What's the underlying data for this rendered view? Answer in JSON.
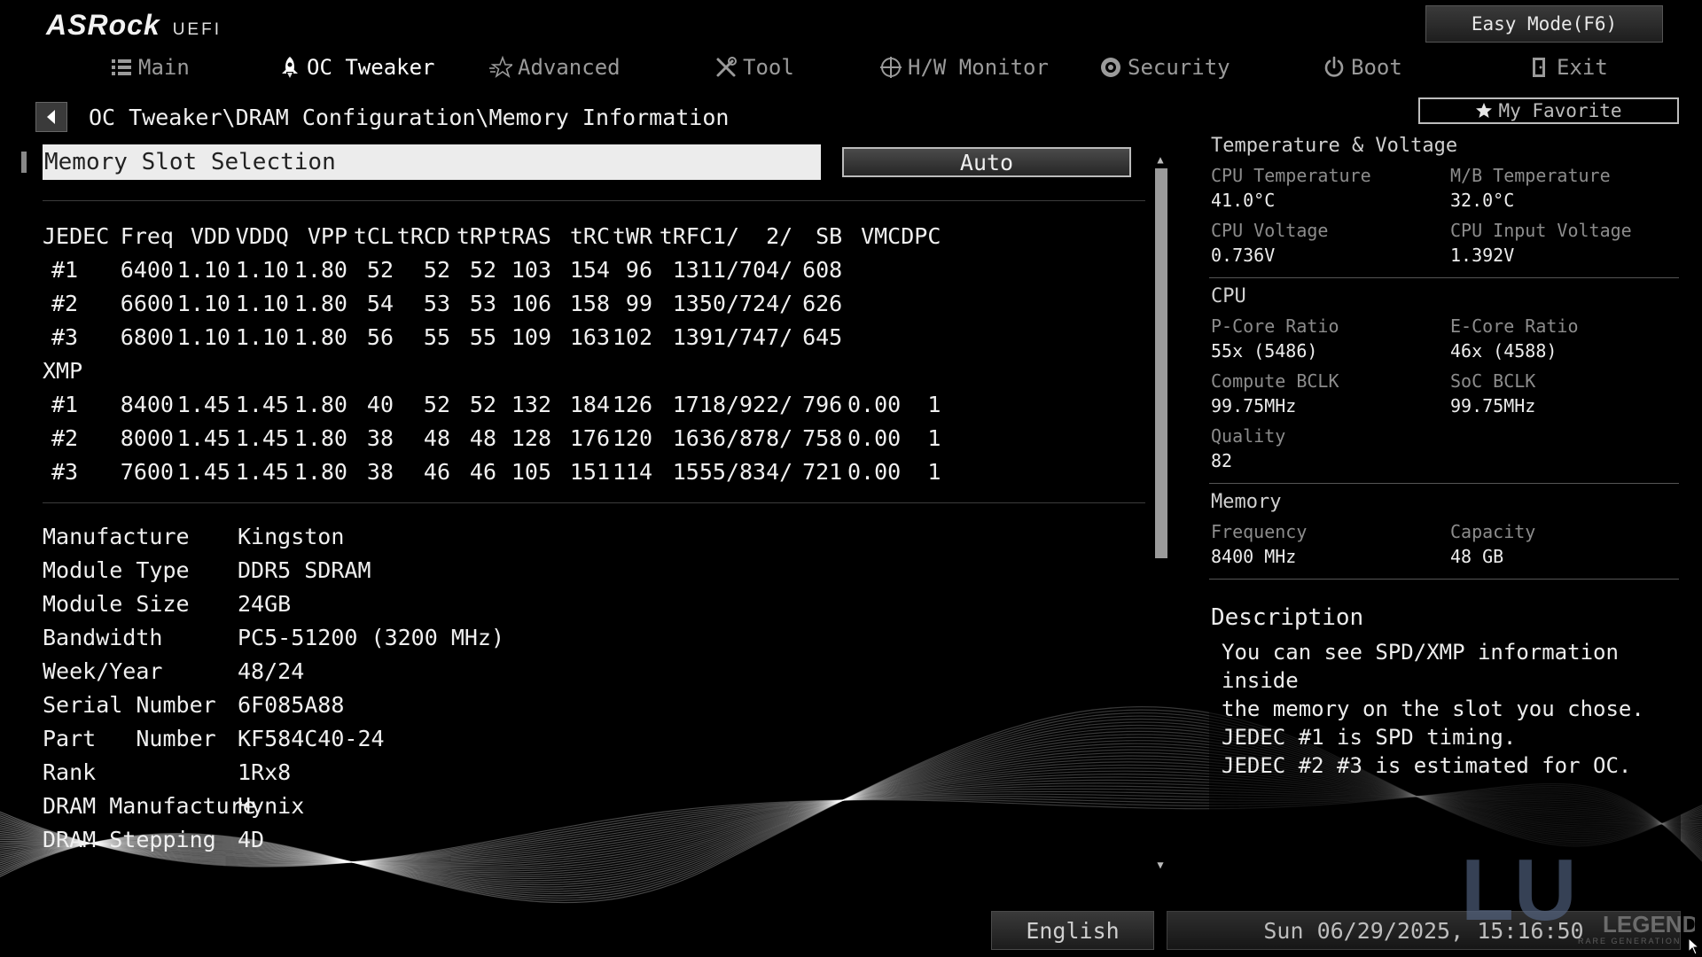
{
  "header": {
    "brand": "ASRock",
    "sub": "UEFI",
    "easy_mode": "Easy Mode(F6)",
    "favorite": "My Favorite"
  },
  "nav": [
    {
      "label": "Main",
      "icon": "list-icon"
    },
    {
      "label": "OC Tweaker",
      "icon": "rocket-icon",
      "active": true
    },
    {
      "label": "Advanced",
      "icon": "star-icon"
    },
    {
      "label": "Tool",
      "icon": "tools-icon"
    },
    {
      "label": "H/W Monitor",
      "icon": "crosshair-icon"
    },
    {
      "label": "Security",
      "icon": "shield-icon"
    },
    {
      "label": "Boot",
      "icon": "power-icon"
    },
    {
      "label": "Exit",
      "icon": "exit-door-icon"
    }
  ],
  "breadcrumb": "OC Tweaker\\DRAM Configuration\\Memory Information",
  "slot": {
    "label": "Memory Slot Selection",
    "value": "Auto"
  },
  "spd": {
    "header": [
      "JEDEC",
      "Freq",
      "VDD",
      "VDDQ",
      "VPP",
      "tCL",
      "tRCD",
      "tRP",
      "tRAS",
      "tRC",
      "tWR",
      "tRFC1/",
      "2/",
      "SB",
      "VMC",
      "DPC"
    ],
    "jedec_rows": [
      [
        "#1",
        "6400",
        "1.10",
        "1.10",
        "1.80",
        "52",
        "52",
        "52",
        "103",
        "154",
        "96",
        "1311/",
        "704/",
        "608",
        "",
        ""
      ],
      [
        "#2",
        "6600",
        "1.10",
        "1.10",
        "1.80",
        "54",
        "53",
        "53",
        "106",
        "158",
        "99",
        "1350/",
        "724/",
        "626",
        "",
        ""
      ],
      [
        "#3",
        "6800",
        "1.10",
        "1.10",
        "1.80",
        "56",
        "55",
        "55",
        "109",
        "163",
        "102",
        "1391/",
        "747/",
        "645",
        "",
        ""
      ]
    ],
    "xmp_label": "XMP",
    "xmp_rows": [
      [
        "#1",
        "8400",
        "1.45",
        "1.45",
        "1.80",
        "40",
        "52",
        "52",
        "132",
        "184",
        "126",
        "1718/",
        "922/",
        "796",
        "0.00",
        "1"
      ],
      [
        "#2",
        "8000",
        "1.45",
        "1.45",
        "1.80",
        "38",
        "48",
        "48",
        "128",
        "176",
        "120",
        "1636/",
        "878/",
        "758",
        "0.00",
        "1"
      ],
      [
        "#3",
        "7600",
        "1.45",
        "1.45",
        "1.80",
        "38",
        "46",
        "46",
        "105",
        "151",
        "114",
        "1555/",
        "834/",
        "721",
        "0.00",
        "1"
      ]
    ]
  },
  "module_info": [
    {
      "key": "Manufacture",
      "value": "Kingston"
    },
    {
      "key": "Module Type",
      "value": "DDR5 SDRAM"
    },
    {
      "key": "Module Size",
      "value": "24GB"
    },
    {
      "key": "Bandwidth",
      "value": "PC5-51200 (3200 MHz)"
    },
    {
      "key": "Week/Year",
      "value": "48/24"
    },
    {
      "key": "Serial Number",
      "value": "6F085A88"
    },
    {
      "key": "Part   Number",
      "value": "KF584C40-24"
    },
    {
      "key": "Rank",
      "value": "1Rx8"
    },
    {
      "key": "DRAM Manufacture",
      "value": "Hynix"
    },
    {
      "key": "DRAM Stepping",
      "value": "4D"
    }
  ],
  "monitor": {
    "temp_voltage": {
      "title": "Temperature & Voltage",
      "cpu_temp_label": "CPU Temperature",
      "cpu_temp": "41.0°C",
      "mb_temp_label": "M/B Temperature",
      "mb_temp": "32.0°C",
      "cpu_voltage_label": "CPU Voltage",
      "cpu_voltage": "0.736V",
      "cpu_input_voltage_label": "CPU Input Voltage",
      "cpu_input_voltage": "1.392V"
    },
    "cpu": {
      "title": "CPU",
      "pcore_label": "P-Core Ratio",
      "pcore": "55x (5486)",
      "ecore_label": "E-Core Ratio",
      "ecore": "46x (4588)",
      "bclk_label": "Compute BCLK",
      "bclk": "99.75MHz",
      "soc_label": "SoC BCLK",
      "soc": "99.75MHz",
      "quality_label": "Quality",
      "quality": "82"
    },
    "memory": {
      "title": "Memory",
      "freq_label": "Frequency",
      "freq": "8400 MHz",
      "cap_label": "Capacity",
      "cap": "48 GB"
    }
  },
  "description": {
    "title": "Description",
    "text": "You can see SPD/XMP information inside\nthe memory on the slot you chose.\nJEDEC #1 is SPD timing.\nJEDEC #2 #3 is estimated for OC."
  },
  "footer": {
    "language": "English",
    "datetime": "Sun 06/29/2025, 15:16:50"
  },
  "watermark": {
    "mark": "LU",
    "word": "LEGEND",
    "tagline": "RARE GENERATION"
  }
}
